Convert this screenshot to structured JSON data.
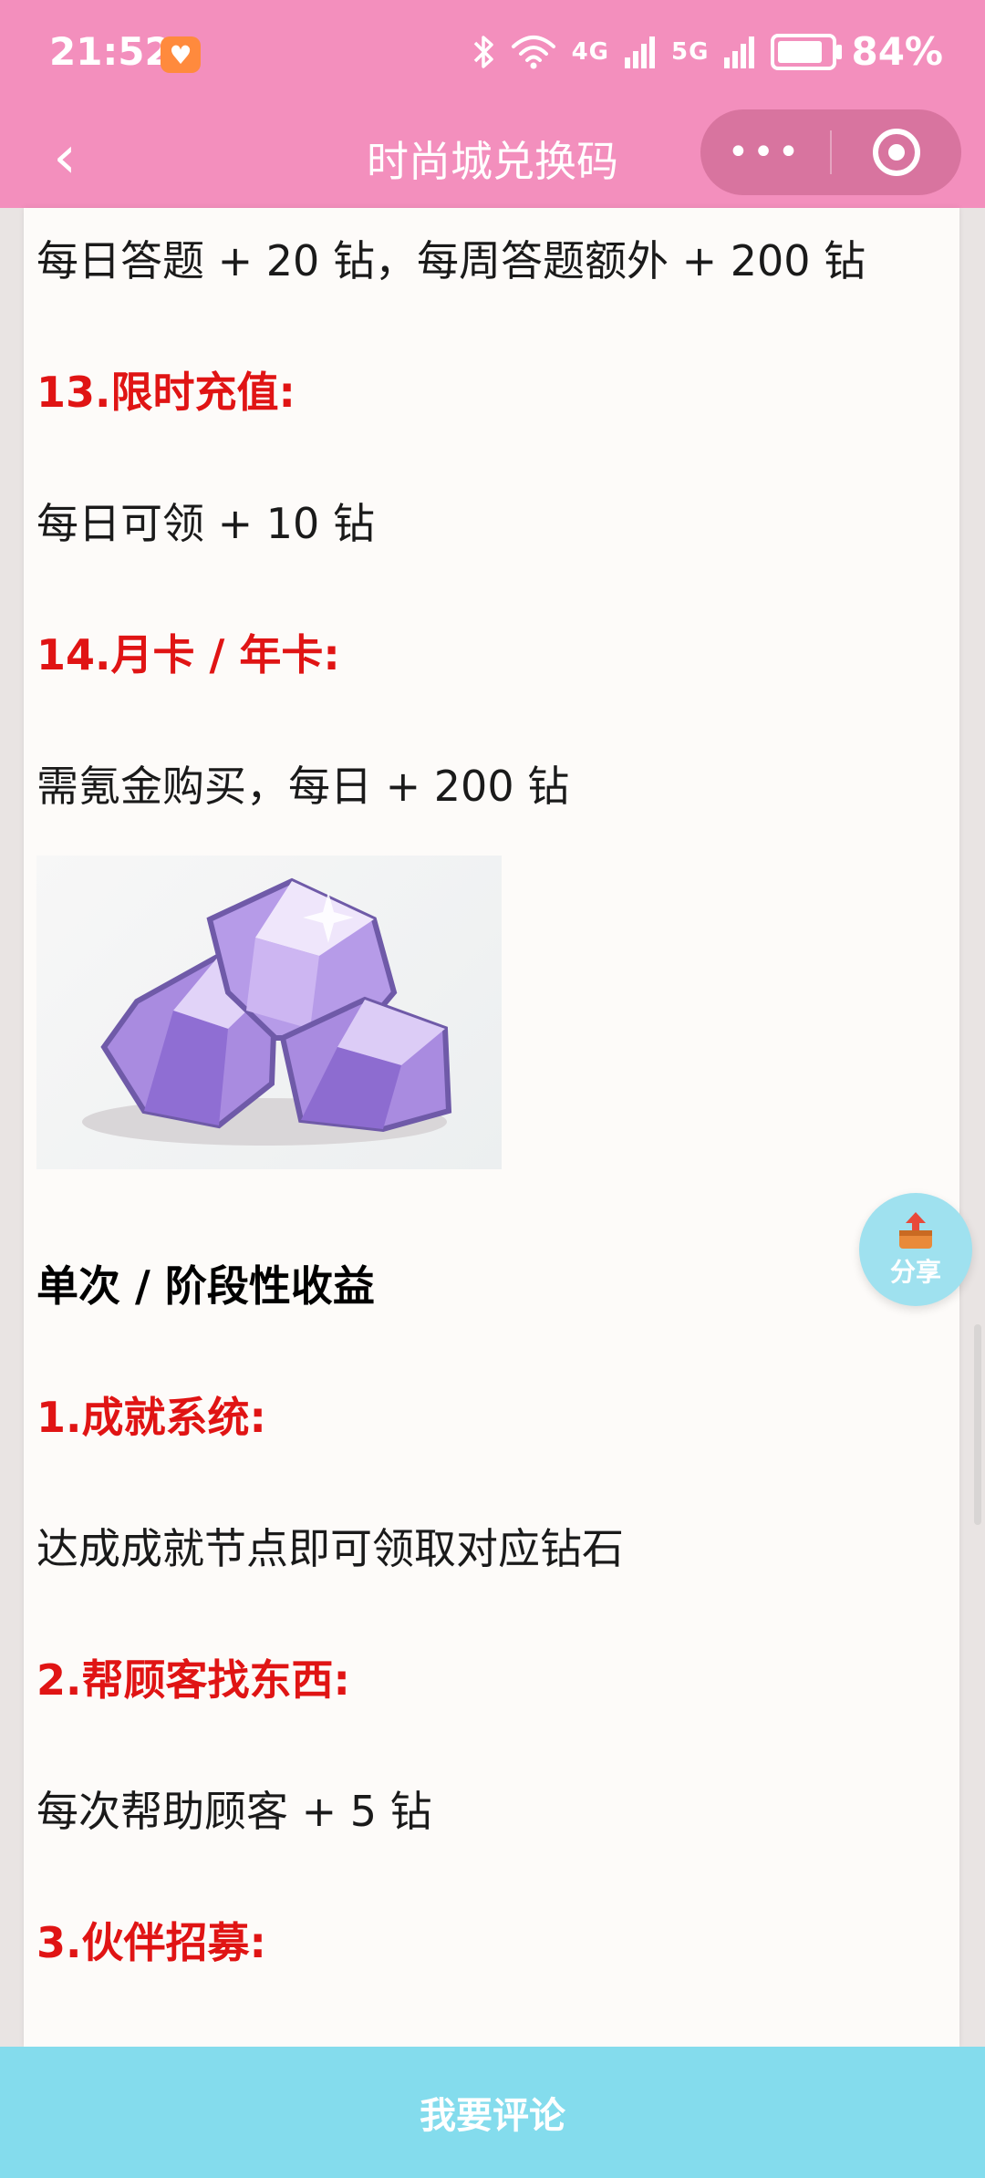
{
  "status_bar": {
    "time": "21:52",
    "signal_4g": "4G",
    "signal_5g": "5G",
    "battery_percent": "84%",
    "battery_level": 0.84
  },
  "nav": {
    "title": "时尚城兑换码",
    "back_glyph": "‹",
    "more_glyph": "•••"
  },
  "content": {
    "lines": [
      "每日答题 + 20 钻，每周答题额外 + 200 钻",
      "13.限时充值:",
      "每日可领 + 10 钻",
      "14.月卡 / 年卡:",
      "需氪金购买，每日 + 200 钻",
      "单次 / 阶段性收益",
      "1.成就系统:",
      "达成成就节点即可领取对应钻石",
      "2.帮顾客找东西:",
      "每次帮助顾客 + 5 钻",
      "3.伙伴招募:"
    ]
  },
  "share": {
    "label": "分享"
  },
  "bottom": {
    "comment_label": "我要评论"
  },
  "colors": {
    "header_pink": "#f38fbd",
    "capsule_pink": "#d8749f",
    "heading_red": "#e01414",
    "bottom_bar": "#84dced",
    "share_fab": "#9fe1ef",
    "gem_purple": "#b58be6"
  }
}
